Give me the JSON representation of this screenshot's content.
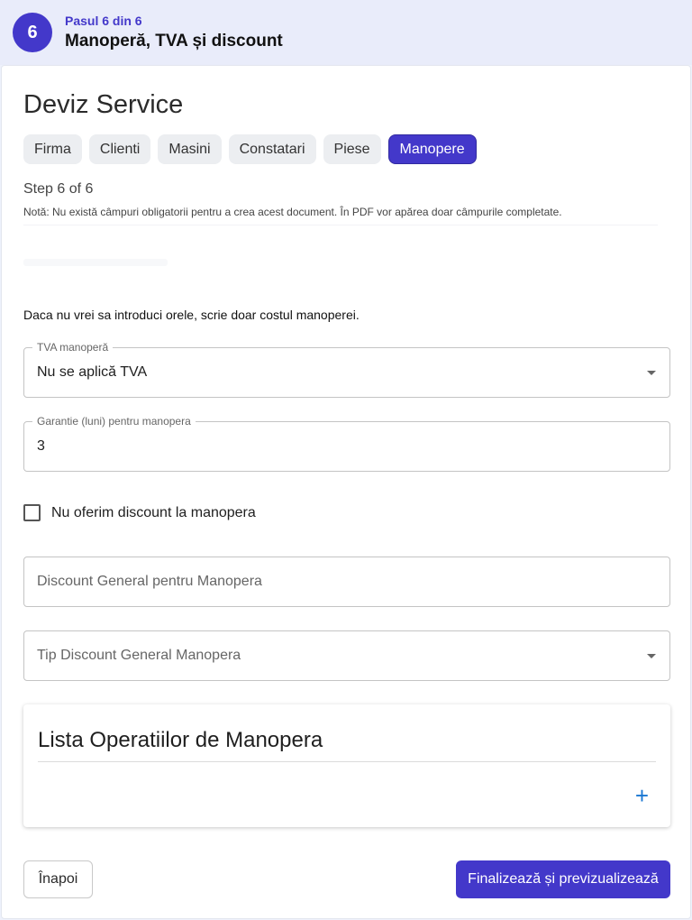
{
  "step_header": {
    "number": "6",
    "small_label": "Pasul 6 din 6",
    "title": "Manoperă, TVA și discount"
  },
  "app": {
    "title": "Deviz Service"
  },
  "tabs": [
    {
      "label": "Firma",
      "active": false
    },
    {
      "label": "Clienti",
      "active": false
    },
    {
      "label": "Masini",
      "active": false
    },
    {
      "label": "Constatari",
      "active": false
    },
    {
      "label": "Piese",
      "active": false
    },
    {
      "label": "Manopere",
      "active": true
    }
  ],
  "progress": {
    "step_text": "Step 6 of 6",
    "note": "Notă: Nu există câmpuri obligatorii pentru a crea acest document. În PDF vor apărea doar câmpurile completate."
  },
  "hint": "Daca nu vrei sa introduci orele, scrie doar costul manoperei.",
  "fields": {
    "tva": {
      "label": "TVA manoperă",
      "value": "Nu se aplică TVA"
    },
    "garantie": {
      "label": "Garantie (luni) pentru manopera",
      "value": "3"
    },
    "discount_general": {
      "placeholder": "Discount General pentru Manopera"
    },
    "tip_discount": {
      "placeholder": "Tip Discount General Manopera"
    }
  },
  "checkbox": {
    "label": "Nu oferim discount la manopera",
    "checked": false
  },
  "operations_panel": {
    "title": "Lista Operatiilor de Manopera",
    "add_symbol": "+"
  },
  "buttons": {
    "back": "Înapoi",
    "finish": "Finalizează și previzualizează"
  },
  "colors": {
    "accent": "#4338ca",
    "add_icon": "#1976d2"
  }
}
